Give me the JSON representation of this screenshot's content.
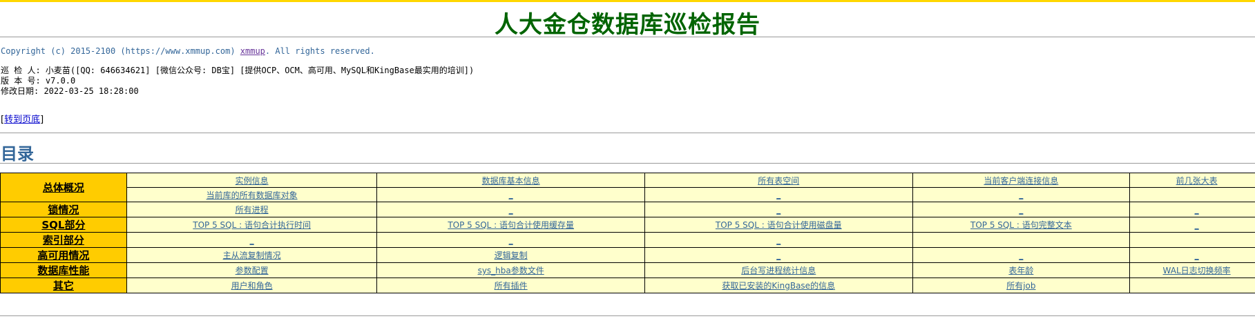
{
  "report": {
    "title": "人大金仓数据库巡检报告",
    "copyright_prefix": "Copyright (c) 2015-2100 (https://www.xmmup.com) ",
    "copyright_link": "xmmup",
    "copyright_suffix": ". All rights reserved.",
    "inspector": "巡 检 人: 小麦苗([QQ: 646634621] [微信公众号: DB宝] [提供OCP、OCM、高可用、MySQL和KingBase最实用的培训])",
    "version": "版 本 号: v7.0.0",
    "modified": "修改日期: 2022-03-25 18:28:00",
    "goto_bottom": "转到页底",
    "toc_heading": "目录"
  },
  "toc": {
    "rows": [
      {
        "category": "总体概况",
        "rowspan": 2,
        "cells": [
          "实例信息",
          "数据库基本信息",
          "所有表空间",
          "当前客户端连接信息",
          "前几张大表"
        ]
      },
      {
        "category": "",
        "rowspan": 0,
        "cells": [
          "当前库的所有数据库对象",
          "_",
          "_",
          "_",
          ""
        ]
      },
      {
        "category": "锁情况",
        "rowspan": 1,
        "cells": [
          "所有进程",
          "_",
          "_",
          "_",
          "_"
        ]
      },
      {
        "category": "SQL部分",
        "rowspan": 1,
        "cells": [
          "TOP 5 SQL : 语句合计执行时间",
          "TOP 5 SQL : 语句合计使用缓存量",
          "TOP 5 SQL : 语句合计使用磁盘量",
          "TOP 5 SQL : 语句完整文本",
          "_"
        ]
      },
      {
        "category": "索引部分",
        "rowspan": 1,
        "cells": [
          "_",
          "_",
          "_",
          "",
          ""
        ]
      },
      {
        "category": "高可用情况",
        "rowspan": 1,
        "cells": [
          "主从流复制情况",
          "逻辑复制",
          "_",
          "_",
          "_"
        ]
      },
      {
        "category": "数据库性能",
        "rowspan": 1,
        "cells": [
          "参数配置",
          "sys_hba参数文件",
          "后台写进程统计信息",
          "表年龄",
          "WAL日志切换频率"
        ]
      },
      {
        "category": "其它",
        "rowspan": 1,
        "cells": [
          "用户和角色",
          "所有插件",
          "获取已安装的KingBase的信息",
          "所有job",
          ""
        ]
      }
    ]
  }
}
